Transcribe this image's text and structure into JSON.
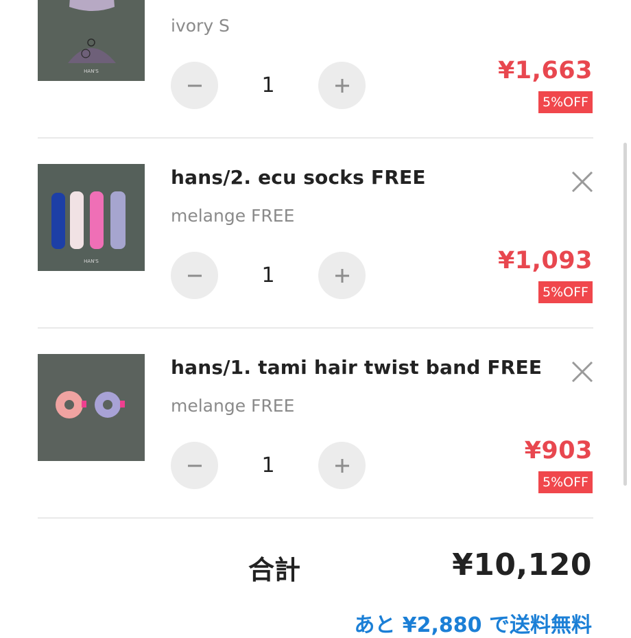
{
  "cart": {
    "items": [
      {
        "title": "",
        "variant": "ivory S",
        "quantity": "1",
        "price": "¥1,663",
        "discount": "5%OFF",
        "thumbnail_icon": "knit-hats-photo"
      },
      {
        "title": "hans/2. ecu socks FREE",
        "variant": "melange FREE",
        "quantity": "1",
        "price": "¥1,093",
        "discount": "5%OFF",
        "thumbnail_icon": "socks-photo"
      },
      {
        "title": "hans/1. tami hair twist band FREE",
        "variant": "melange FREE",
        "quantity": "1",
        "price": "¥903",
        "discount": "5%OFF",
        "thumbnail_icon": "scrunchies-photo"
      }
    ],
    "thumbnail_caption": "HAN'S"
  },
  "summary": {
    "total_label": "合計",
    "total_value": "¥10,120",
    "free_shipping_note": "あと ¥2,880 で送料無料"
  },
  "colors": {
    "price": "#e8474f",
    "discount_badge": "#f0474c",
    "link": "#1b7fd6",
    "thumbnail_bg": "#58605a"
  }
}
